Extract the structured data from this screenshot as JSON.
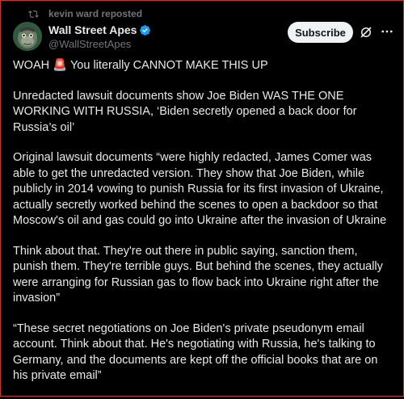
{
  "repost": {
    "text": "kevin ward reposted",
    "icon": "repost-icon"
  },
  "author": {
    "name": "Wall Street Apes",
    "handle": "@WallStreetApes",
    "verified": true,
    "verified_color": "#1d9bf0"
  },
  "actions": {
    "subscribe_label": "Subscribe",
    "grok_icon": "grok-icon",
    "more_icon": "more-icon"
  },
  "post": {
    "paragraphs": [
      "WOAH 🚨 You literally CANNOT MAKE THIS UP",
      "Unredacted lawsuit documents show Joe Biden WAS THE ONE WORKING WITH RUSSIA, ‘Biden secretly opened a back door for Russia’s oil’",
      "Original lawsuit documents “were highly redacted, James Comer was able to get the unredacted version. They show that Joe Biden, while publicly in 2014 vowing to punish Russia for its first invasion of Ukraine, actually secretly worked behind the scenes to open a backdoor so that Moscow's oil and gas could go into Ukraine after the invasion of Ukraine",
      "Think about that. They're out there in public saying, sanction them, punish them. They're terrible guys. But behind the scenes, they actually were arranging for Russian gas to flow back into Ukraine right after the invasion”",
      "“These secret negotiations on Joe Biden's private pseudonym email account. Think about that. He's negotiating with Russia, he's talking to Germany, and the documents are kept off the official books that are on his private email”"
    ]
  },
  "colors": {
    "background": "#000000",
    "text": "#e7e9ea",
    "muted": "#71767b",
    "accent": "#1d9bf0",
    "button_bg": "#eff3f4"
  }
}
